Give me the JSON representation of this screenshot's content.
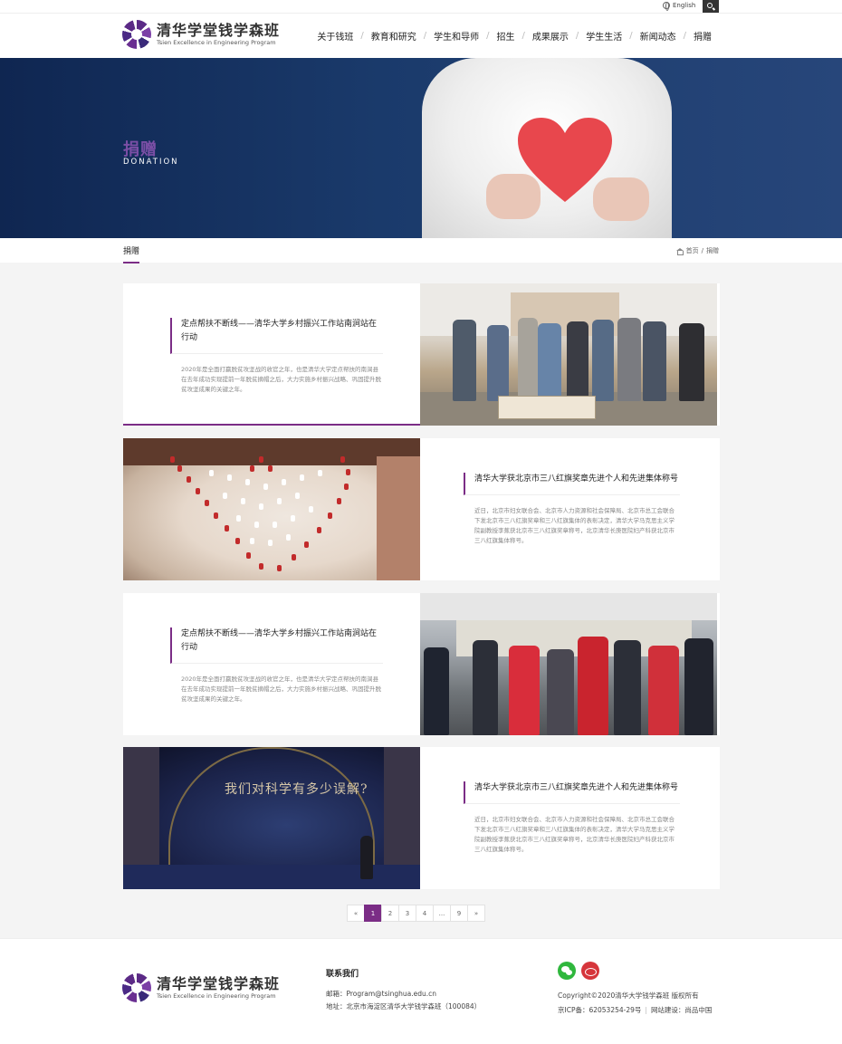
{
  "topbar": {
    "language": "English"
  },
  "brand": {
    "name_cn": "清华学堂钱学森班",
    "name_en": "Tsien Excellence in Engineering Program"
  },
  "nav": [
    "关于钱班",
    "教育和研究",
    "学生和导师",
    "招生",
    "成果展示",
    "学生生活",
    "新闻动态",
    "捐赠"
  ],
  "banner": {
    "title": "捐赠",
    "subtitle": "DONATION"
  },
  "subnav": {
    "tab": "捐赠",
    "breadcrumb_home": "首页",
    "breadcrumb_sep": "/",
    "breadcrumb_current": "捐赠"
  },
  "articles": [
    {
      "title": "定点帮扶不断线——清华大学乡村振兴工作站南涧站在行动",
      "summary": "2020年是全面打赢脱贫攻坚战的收官之年，也是清华大学定点帮扶的南涧县在去年成功实现提前一年脱贫摘帽之后，大力实施乡村振兴战略、巩固提升脱贫攻坚成果的关键之年。"
    },
    {
      "title": "清华大学获北京市三八红旗奖章先进个人和先进集体称号",
      "summary": "近日，北京市妇女联合会、北京市人力资源和社会保障局、北京市总工会联合下发北京市三八红旗奖章和三八红旗集体的表彰决定，清华大学马克思主义学院副教授李蕉获北京市三八红旗奖章称号，北京清华长庚医院妇产科获北京市三八红旗集体称号。"
    },
    {
      "title": "定点帮扶不断线——清华大学乡村振兴工作站南涧站在行动",
      "summary": "2020年是全面打赢脱贫攻坚战的收官之年，也是清华大学定点帮扶的南涧县在去年成功实现提前一年脱贫摘帽之后，大力实施乡村振兴战略、巩固提升脱贫攻坚成果的关键之年。"
    },
    {
      "title": "清华大学获北京市三八红旗奖章先进个人和先进集体称号",
      "summary": "近日，北京市妇女联合会、北京市人力资源和社会保障局、北京市总工会联合下发北京市三八红旗奖章和三八红旗集体的表彰决定，清华大学马克思主义学院副教授李蕉获北京市三八红旗奖章称号，北京清华长庚医院妇产科获北京市三八红旗集体称号。"
    }
  ],
  "photo4_caption": "我们对科学有多少误解?",
  "pagination": [
    "«",
    "1",
    "2",
    "3",
    "4",
    "...",
    "9",
    "»"
  ],
  "footer": {
    "contact_heading": "联系我们",
    "email": "邮箱：Program@tsinghua.edu.cn",
    "address": "地址：北京市海淀区清华大学钱学森班（100084）",
    "copyright": "Copyright©2020清华大学钱学森班 版权所有",
    "icp": "京ICP备：62053254-29号",
    "separator": "|",
    "credit": "网站建设：尚品中国"
  },
  "colors": {
    "accent": "#7b2d86",
    "banner": "#1a3a6b"
  },
  "icons": [
    "globe-icon",
    "search-icon",
    "home-icon",
    "wechat-icon",
    "weibo-icon"
  ]
}
